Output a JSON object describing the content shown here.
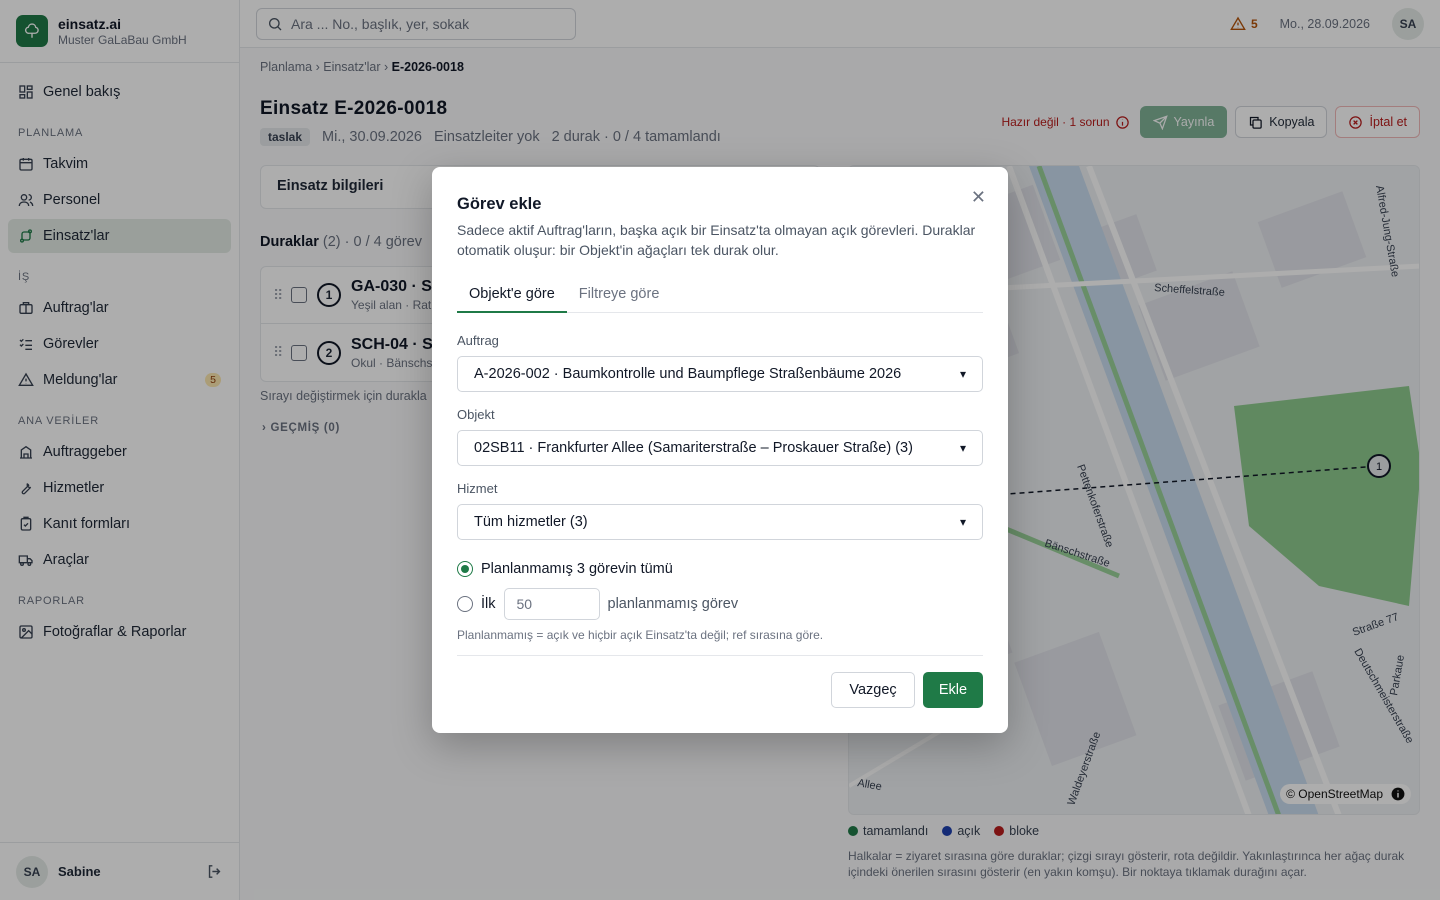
{
  "brand": {
    "name": "einsatz.ai",
    "company": "Muster GaLaBau GmbH"
  },
  "nav": {
    "overview": "Genel bakış",
    "section_planning": "PLANLAMA",
    "calendar": "Takvim",
    "staff": "Personel",
    "einsatz": "Einsatz'lar",
    "section_work": "İŞ",
    "orders": "Auftrag'lar",
    "tasks": "Görevler",
    "reports_msgs": "Meldung'lar",
    "reports_msgs_badge": "5",
    "section_master": "ANA VERİLER",
    "clients": "Auftraggeber",
    "services": "Hizmetler",
    "forms": "Kanıt formları",
    "vehicles": "Araçlar",
    "section_reports": "RAPORLAR",
    "photos": "Fotoğraflar & Raporlar"
  },
  "user": {
    "initials": "SA",
    "name": "Sabine"
  },
  "topbar": {
    "search_placeholder": "Ara ... No., başlık, yer, sokak",
    "warnings": "5",
    "date": "Mo., 28.09.2026",
    "avatar": "SA"
  },
  "breadcrumb": {
    "a": "Planlama",
    "b": "Einsatz'lar",
    "current": "E-2026-0018"
  },
  "einsatz": {
    "title": "Einsatz E-2026-0018",
    "status": "taslak",
    "date": "Mi., 30.09.2026",
    "leader": "Einsatzleiter yok",
    "progress": "2 durak · 0 / 4 tamamlandı",
    "not_ready": "Hazır değil · 1 sorun",
    "publish": "Yayınla",
    "copy": "Kopyala",
    "cancel": "İptal et",
    "info_card": "Einsatz bilgileri",
    "stops_label": "Duraklar",
    "stops_count": "(2) · 0 / 4 görev",
    "stops": [
      {
        "n": "1",
        "title": "GA-030 · S",
        "sub": "Yeşil alan · Rath"
      },
      {
        "n": "2",
        "title": "SCH-04 · S",
        "sub": "Okul · Bänschs"
      }
    ],
    "reorder_hint": "Sırayı değiştirmek için durakla",
    "history": "GEÇMİŞ (0)"
  },
  "map": {
    "attribution": "© OpenStreetMap",
    "streets": [
      "Scheffelstraße",
      "Alfred-Jung-Straße",
      "Pettenkoferstraße",
      "Bänschstraße",
      "Waldeyerstraße",
      "Deutschmeisterstraße",
      "Straße 77",
      "Parkaue",
      "Allee"
    ],
    "marker": "1",
    "legend": [
      {
        "label": "tamamlandı",
        "color": "#1f7a47"
      },
      {
        "label": "açık",
        "color": "#1e40af"
      },
      {
        "label": "bloke",
        "color": "#b91c1c"
      }
    ],
    "note": "Halkalar = ziyaret sırasına göre duraklar; çizgi sırayı gösterir, rota değildir. Yakınlaştırınca her ağaç durak içindeki önerilen sırasını gösterir (en yakın komşu). Bir noktaya tıklamak durağını açar."
  },
  "modal": {
    "title": "Görev ekle",
    "desc": "Sadece aktif Auftrag'ların, başka açık bir Einsatz'ta olmayan açık görevleri. Duraklar otomatik oluşur: bir Objekt'in ağaçları tek durak olur.",
    "tab_object": "Objekt'e göre",
    "tab_filter": "Filtreye göre",
    "label_order": "Auftrag",
    "order_value": "A-2026-002 · Baumkontrolle und Baumpflege Straßenbäume 2026",
    "label_object": "Objekt",
    "object_value": "02SB11 · Frankfurter Allee (Samariterstraße – Proskauer Straße) (3)",
    "label_service": "Hizmet",
    "service_value": "Tüm hizmetler (3)",
    "radio_all": "Planlanmamış 3 görevin tümü",
    "radio_first": "İlk",
    "first_value": "50",
    "first_suffix": "planlanmamış görev",
    "note": "Planlanmamış = açık ve hiçbir açık Einsatz'ta değil; ref sırasına göre.",
    "cancel": "Vazgeç",
    "add": "Ekle"
  }
}
